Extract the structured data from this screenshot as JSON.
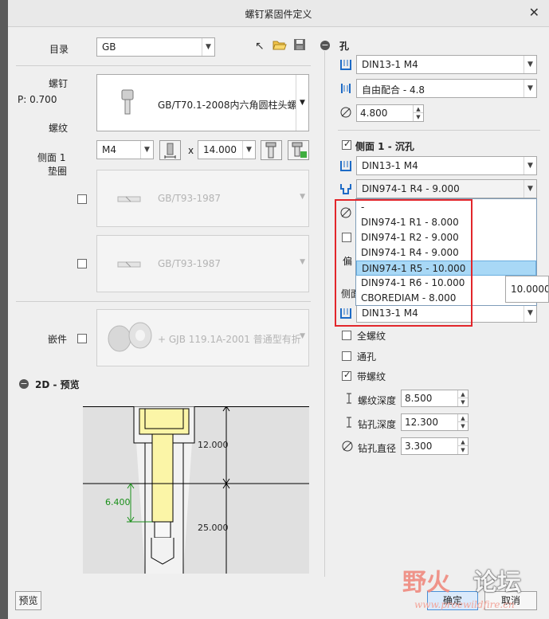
{
  "window": {
    "title": "螺钉紧固件定义",
    "close": "✕"
  },
  "catalog": {
    "label": "目录",
    "value": "GB"
  },
  "screw": {
    "label": "螺钉",
    "pitch": "P: 0.700",
    "thread_label": "螺纹",
    "part": "GB/T70.1-2008内六角圆柱头螺",
    "size": "M4",
    "times": "x",
    "length": "14.000"
  },
  "side1": {
    "label1": "侧面 1",
    "label2": "垫圈",
    "washer1": "GB/T93-1987",
    "washer2": "GB/T93-1987"
  },
  "insert": {
    "label": "嵌件",
    "part": "+ GJB 119.1A-2001 普通型有折"
  },
  "preview": {
    "header": "2D - 预览",
    "dim_12": "12.000",
    "dim_6_4": "6.400",
    "dim_25": "25.000",
    "button": "预览"
  },
  "hole": {
    "header": "孔",
    "standard": "DIN13-1 M4",
    "fit": "自由配合 - 4.8",
    "diameter": "4.800"
  },
  "side1_cbore": {
    "header": "侧面 1 - 沉孔",
    "standard": "DIN13-1 M4",
    "cbore": "DIN974-1 R4 - 9.000",
    "options": [
      "-",
      "DIN974-1 R1 - 8.000",
      "DIN974-1 R2 - 9.000",
      "DIN974-1 R4 - 9.000",
      "DIN974-1 R5 - 10.000",
      "DIN974-1 R6 - 10.000",
      "CBOREDIAM - 8.000"
    ],
    "highlighted_option": "DIN974-1 R5 - 10.000",
    "tooltip": "10.00000",
    "hidden_label_a": "偏",
    "hidden_label_b": "侧面",
    "side2_standard": "DIN13-1 M4"
  },
  "options": {
    "full_thread": "全螺纹",
    "through_hole": "通孔",
    "with_thread": "带螺纹",
    "thread_depth_label": "螺纹深度",
    "thread_depth": "8.500",
    "drill_depth_label": "钻孔深度",
    "drill_depth": "12.300",
    "drill_dia_label": "钻孔直径",
    "drill_dia": "3.300"
  },
  "buttons": {
    "ok": "确定",
    "cancel": "取消"
  },
  "watermark": {
    "a": "野火",
    "b": "论坛",
    "c": "www.proewildfire.cn"
  },
  "colors": {
    "accent": "#1e6bc6",
    "highlight": "#a8d8f6",
    "red": "#e2262b",
    "screw": "#fbf5a7",
    "dim_green": "#1a8f1a"
  }
}
